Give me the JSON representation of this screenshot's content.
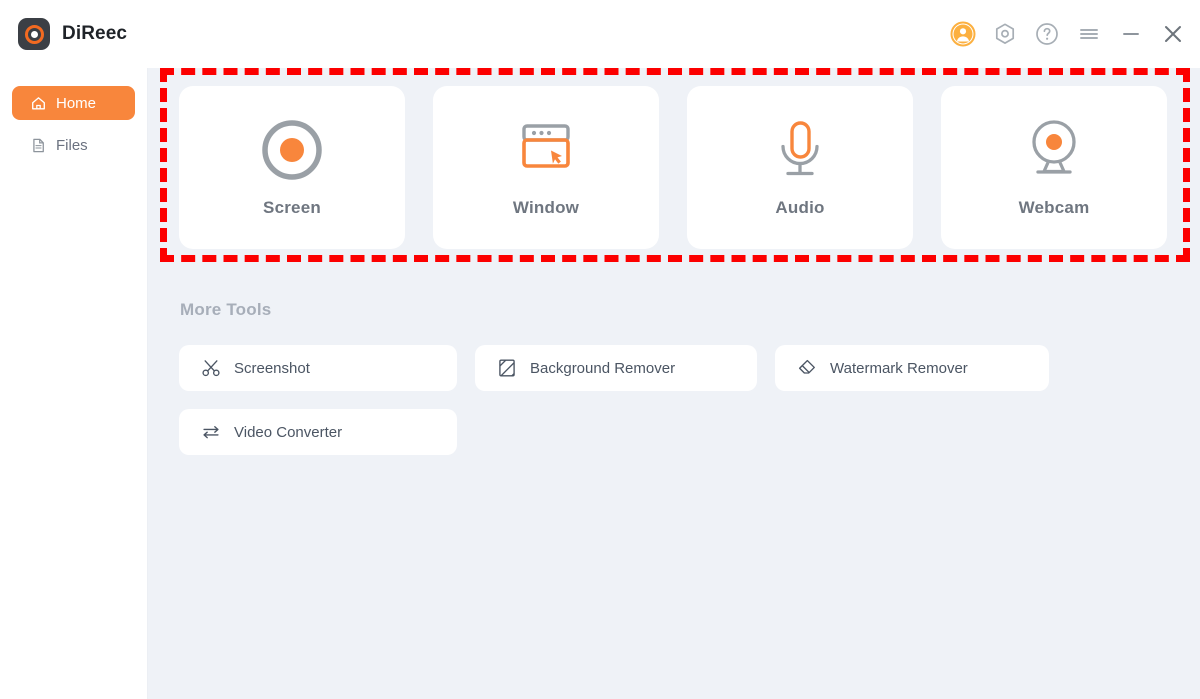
{
  "app": {
    "title": "DiReec",
    "logo_icon": "direec-record-logo-icon",
    "accent_color": "#f8863c",
    "main_bg_color": "#eff2f7",
    "annotation_color": "#fc0000"
  },
  "titlebar": {
    "actions": [
      {
        "name": "account-avatar-icon",
        "label": "Account"
      },
      {
        "name": "settings-gear-icon",
        "label": "Settings"
      },
      {
        "name": "help-question-icon",
        "label": "Help"
      },
      {
        "name": "menu-hamburger-icon",
        "label": "Menu"
      },
      {
        "name": "minimize-icon",
        "label": "Minimize"
      },
      {
        "name": "close-icon",
        "label": "Close"
      }
    ]
  },
  "sidebar": {
    "items": [
      {
        "label": "Home",
        "icon": "home-icon",
        "active": true
      },
      {
        "label": "Files",
        "icon": "file-icon",
        "active": false
      }
    ]
  },
  "main": {
    "record_cards": [
      {
        "label": "Screen",
        "icon": "record-circle-icon"
      },
      {
        "label": "Window",
        "icon": "window-cursor-icon"
      },
      {
        "label": "Audio",
        "icon": "microphone-icon"
      },
      {
        "label": "Webcam",
        "icon": "webcam-icon"
      }
    ],
    "more_tools_title": "More Tools",
    "tools": [
      {
        "label": "Screenshot",
        "icon": "scissors-icon"
      },
      {
        "label": "Background Remover",
        "icon": "hatched-square-icon"
      },
      {
        "label": "Watermark Remover",
        "icon": "eraser-icon"
      },
      {
        "label": "Video Converter",
        "icon": "convert-arrows-icon"
      }
    ]
  }
}
